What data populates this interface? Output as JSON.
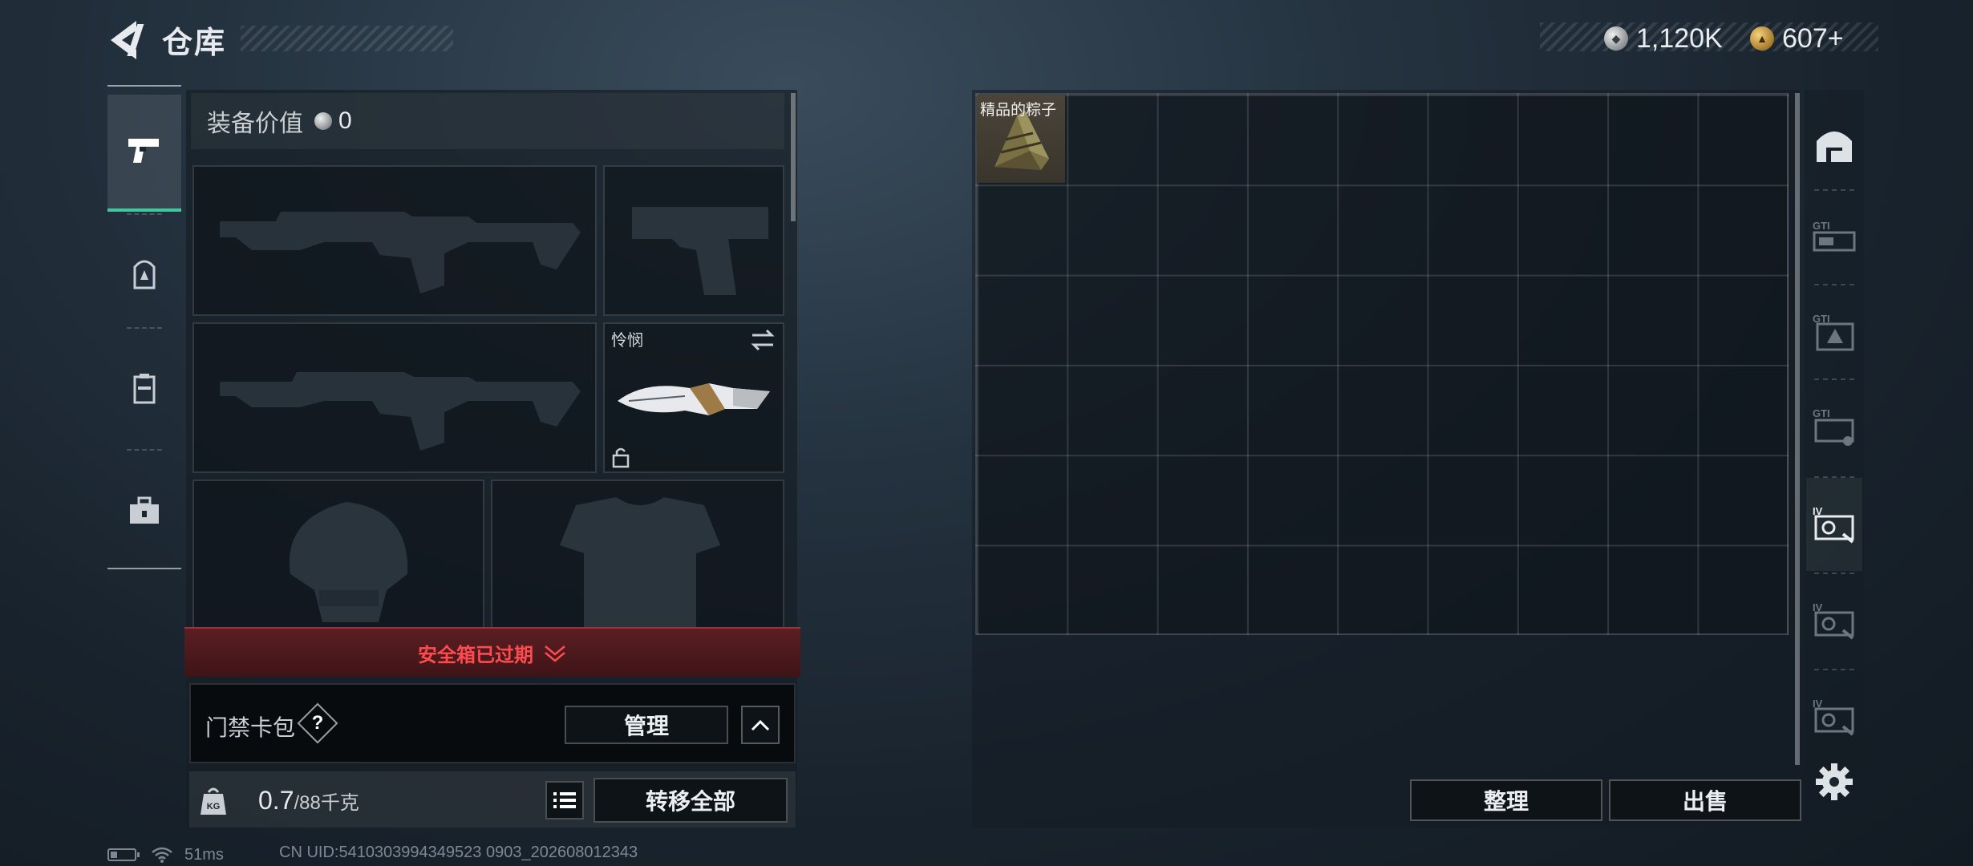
{
  "header": {
    "title": "仓库",
    "back_icon": "back-arrow-icon",
    "currency_silver": "1,120K",
    "currency_gold": "607+"
  },
  "left_tabs": [
    {
      "name": "pistol-icon",
      "active": true
    },
    {
      "name": "backpack-icon",
      "active": false
    },
    {
      "name": "vest-icon",
      "active": false
    },
    {
      "name": "toolbox-icon",
      "active": false
    }
  ],
  "equipment": {
    "value_label": "装备价值",
    "value": "0",
    "melee_label": "怜悯"
  },
  "safe_box": {
    "status": "安全箱已过期"
  },
  "keycard": {
    "label": "门禁卡包",
    "help": "?",
    "manage_label": "管理"
  },
  "weight": {
    "current": "0.7",
    "max": "/88千克"
  },
  "actions": {
    "transfer_all": "转移全部",
    "sort": "整理",
    "sell": "出售"
  },
  "storage": {
    "item_label": "精品的粽子"
  },
  "right_tabs": [
    "storage-home-icon",
    "storage-tier-1-icon",
    "storage-tier-2-icon",
    "storage-tier-3-icon",
    "storage-tier-4-active-icon",
    "storage-tier-5-icon",
    "storage-tier-6-icon"
  ],
  "status": {
    "ping": "51ms",
    "uid": "CN UID:5410303994349523 0903_202608012343"
  },
  "colors": {
    "accent": "#3fc7a0",
    "danger": "#ff4b4f",
    "danger_bg": "#4a171b"
  }
}
